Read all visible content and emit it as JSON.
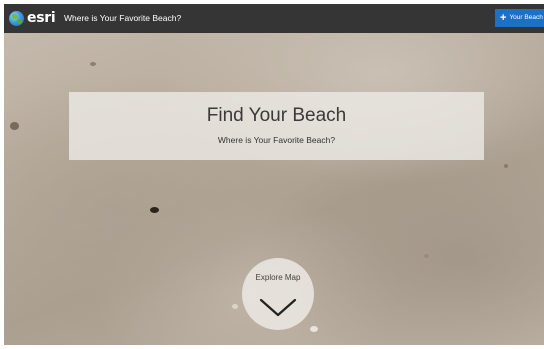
{
  "header": {
    "logo_text": "esri",
    "logo_icon": "esri-globe-icon",
    "app_title": "Where is Your Favorite Beach?",
    "add_button_label": "Your Beach",
    "add_button_icon": "plus-icon",
    "accent_color": "#1f6fc2",
    "bar_color": "#353535"
  },
  "hero": {
    "title": "Find Your Beach",
    "subtitle": "Where is Your Favorite Beach?"
  },
  "explore": {
    "label": "Explore Map",
    "icon": "chevron-down-icon"
  }
}
